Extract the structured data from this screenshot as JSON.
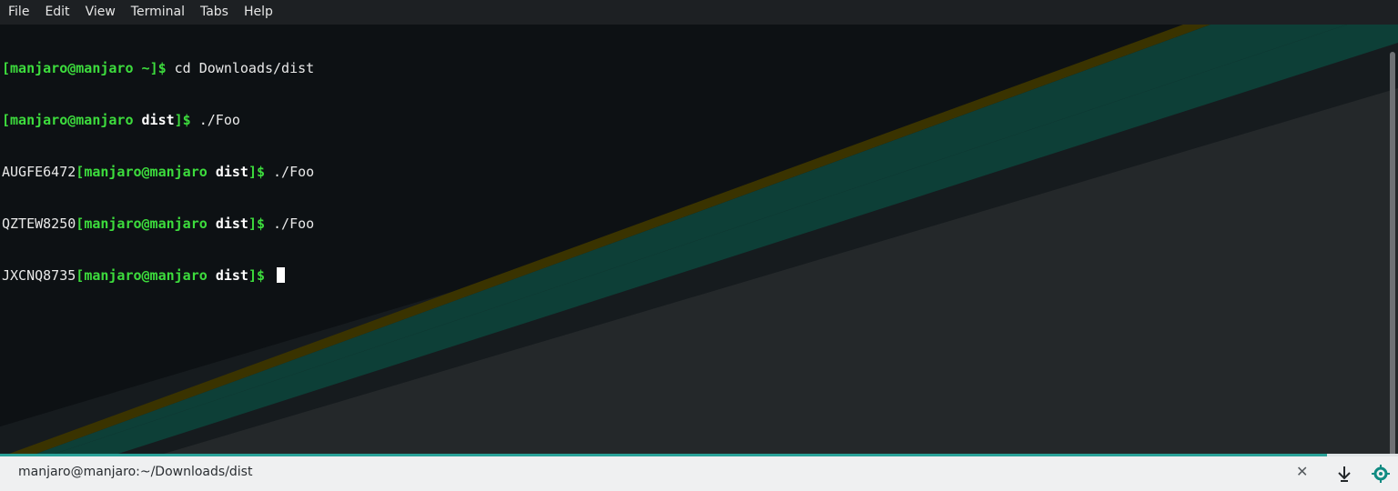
{
  "menu": [
    "File",
    "Edit",
    "View",
    "Terminal",
    "Tabs",
    "Help"
  ],
  "terminal": {
    "lines": [
      {
        "pre": "",
        "user": "manjaro@manjaro",
        "dir": "~",
        "cmd": " cd Downloads/dist"
      },
      {
        "pre": "",
        "user": "manjaro@manjaro",
        "dir": "dist",
        "cmd": " ./Foo"
      },
      {
        "pre": "AUGFE6472",
        "user": "manjaro@manjaro",
        "dir": "dist",
        "cmd": " ./Foo"
      },
      {
        "pre": "QZTEW8250",
        "user": "manjaro@manjaro",
        "dir": "dist",
        "cmd": " ./Foo"
      },
      {
        "pre": "JXCNQ8735",
        "user": "manjaro@manjaro",
        "dir": "dist",
        "cmd": " "
      }
    ]
  },
  "tab": {
    "title": "manjaro@manjaro:~/Downloads/dist",
    "close_icon": "close-icon",
    "new_tab_icon": "download-arrow-icon",
    "settings_icon": "settings-gear-icon"
  },
  "colors": {
    "prompt": "#3ddc3d",
    "accent": "#2aa198",
    "stripe_yellow": "#3a3300",
    "stripe_teal": "#0d3f37"
  }
}
